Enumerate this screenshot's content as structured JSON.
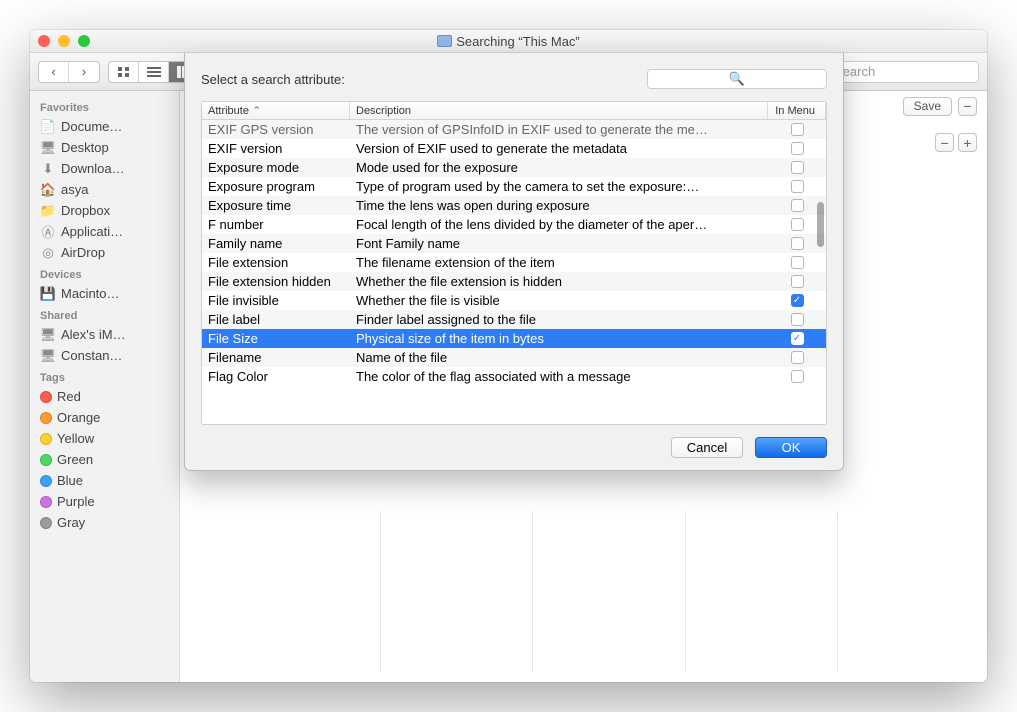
{
  "window": {
    "title": "Searching “This Mac”"
  },
  "toolbar": {
    "search_placeholder": "Search"
  },
  "sidebar": {
    "groups": [
      {
        "label": "Favorites",
        "items": [
          {
            "icon": "doc",
            "label": "Docume…"
          },
          {
            "icon": "desktop",
            "label": "Desktop"
          },
          {
            "icon": "download",
            "label": "Downloa…"
          },
          {
            "icon": "home",
            "label": "asya"
          },
          {
            "icon": "folder",
            "label": "Dropbox"
          },
          {
            "icon": "apps",
            "label": "Applicati…"
          },
          {
            "icon": "airdrop",
            "label": "AirDrop"
          }
        ]
      },
      {
        "label": "Devices",
        "items": [
          {
            "icon": "disk",
            "label": "Macinto…"
          }
        ]
      },
      {
        "label": "Shared",
        "items": [
          {
            "icon": "imac",
            "label": "Alex's iM…"
          },
          {
            "icon": "monitor",
            "label": "Constan…"
          }
        ]
      },
      {
        "label": "Tags",
        "items": [
          {
            "color": "#ff5b4f",
            "label": "Red"
          },
          {
            "color": "#ff9a2f",
            "label": "Orange"
          },
          {
            "color": "#ffd02f",
            "label": "Yellow"
          },
          {
            "color": "#4cd964",
            "label": "Green"
          },
          {
            "color": "#3aa3ff",
            "label": "Blue"
          },
          {
            "color": "#cc73e1",
            "label": "Purple"
          },
          {
            "color": "#9b9b9b",
            "label": "Gray"
          }
        ]
      }
    ]
  },
  "savebar": {
    "save_label": "Save"
  },
  "sheet": {
    "prompt": "Select a search attribute:",
    "headers": {
      "attribute": "Attribute",
      "description": "Description",
      "in_menu": "In Menu"
    },
    "rows": [
      {
        "attr": "EXIF GPS version",
        "desc": "The version of GPSInfoID in EXIF used to generate the me…",
        "checked": false,
        "cut": true
      },
      {
        "attr": "EXIF version",
        "desc": "Version of EXIF used to generate the metadata",
        "checked": false
      },
      {
        "attr": "Exposure mode",
        "desc": "Mode used for the exposure",
        "checked": false
      },
      {
        "attr": "Exposure program",
        "desc": "Type of program used by the camera to set the exposure:…",
        "checked": false
      },
      {
        "attr": "Exposure time",
        "desc": "Time the lens was open during exposure",
        "checked": false
      },
      {
        "attr": "F number",
        "desc": "Focal length of the lens divided by the diameter of the aper…",
        "checked": false
      },
      {
        "attr": "Family name",
        "desc": "Font Family name",
        "checked": false
      },
      {
        "attr": "File extension",
        "desc": "The filename extension of the item",
        "checked": false
      },
      {
        "attr": "File extension hidden",
        "desc": "Whether the file extension is hidden",
        "checked": false
      },
      {
        "attr": "File invisible",
        "desc": "Whether the file is visible",
        "checked": true
      },
      {
        "attr": "File label",
        "desc": "Finder label assigned to the file",
        "checked": false
      },
      {
        "attr": "File Size",
        "desc": "Physical size of the item in bytes",
        "checked": true,
        "selected": true
      },
      {
        "attr": "Filename",
        "desc": "Name of the file",
        "checked": false
      },
      {
        "attr": "Flag Color",
        "desc": "The color of the flag associated with a message",
        "checked": false
      }
    ],
    "cancel_label": "Cancel",
    "ok_label": "OK"
  }
}
